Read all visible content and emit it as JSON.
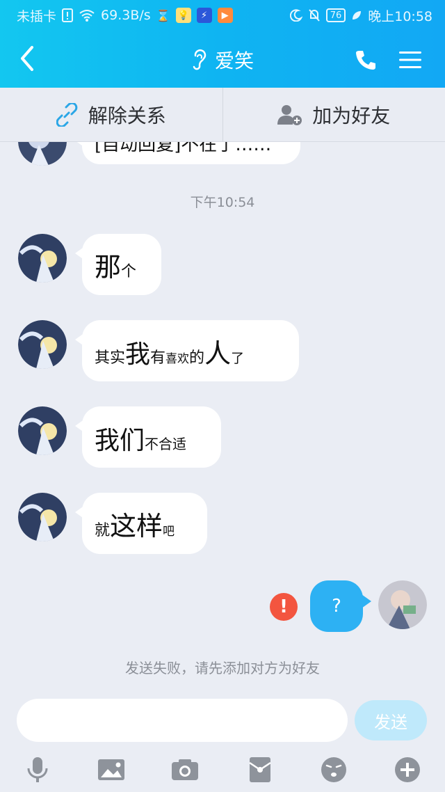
{
  "status_bar": {
    "carrier": "未插卡",
    "speed": "69.3B/s",
    "battery": "76",
    "time": "晚上10:58"
  },
  "header": {
    "contact_name": "爱笑",
    "icons": {
      "back": "chevron-left-icon",
      "ear": "ear-icon",
      "phone": "phone-icon",
      "menu": "menu-icon"
    }
  },
  "relation_bar": {
    "unlink_label": "解除关系",
    "add_friend_label": "加为好友"
  },
  "chat": {
    "partial_top_message": "[自动回复]不在了……",
    "time_divider": "下午10:54",
    "messages": [
      {
        "id": "m1",
        "parts": [
          {
            "t": "那",
            "s": 38
          },
          {
            "t": "个",
            "s": 22
          }
        ]
      },
      {
        "id": "m2",
        "parts": [
          {
            "t": "其实",
            "s": 22
          },
          {
            "t": "我",
            "s": 36
          },
          {
            "t": "有",
            "s": 22
          },
          {
            "t": "喜欢",
            "s": 17
          },
          {
            "t": "的",
            "s": 22
          },
          {
            "t": "人",
            "s": 38
          },
          {
            "t": "了",
            "s": 19
          }
        ]
      },
      {
        "id": "m3",
        "parts": [
          {
            "t": "我们",
            "s": 36
          },
          {
            "t": "不合适",
            "s": 20
          }
        ]
      },
      {
        "id": "m4",
        "parts": [
          {
            "t": "就",
            "s": 22
          },
          {
            "t": "这样",
            "s": 38
          },
          {
            "t": "吧",
            "s": 17
          }
        ]
      }
    ],
    "self_message": "?",
    "send_failed_notice": "发送失败，请先添加对方为好友"
  },
  "input_bar": {
    "placeholder": "",
    "send_label": "发送"
  },
  "colors": {
    "header_gradient_start": "#13c7f0",
    "header_gradient_end": "#12a8f4",
    "self_bubble": "#2db1f3",
    "error": "#f3553f",
    "send_disabled": "#bfe9fb"
  }
}
